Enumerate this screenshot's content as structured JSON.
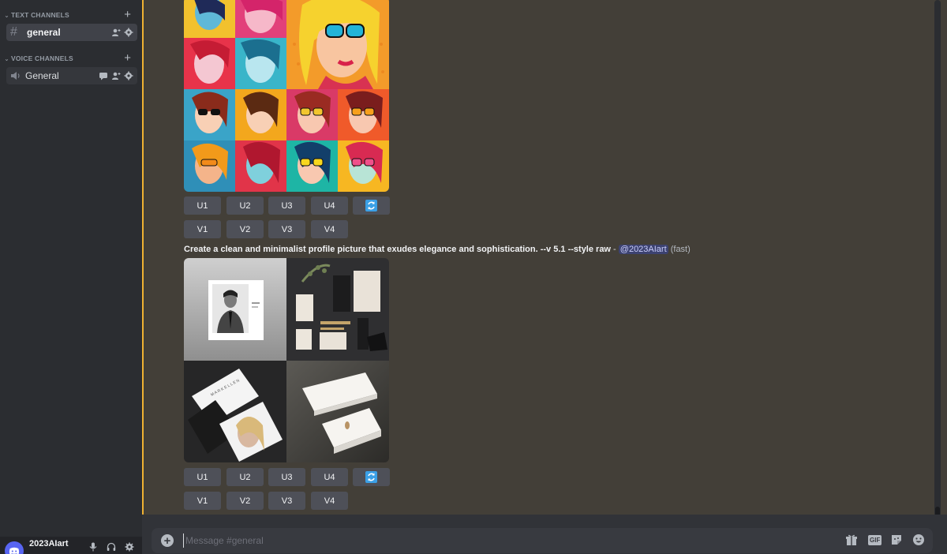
{
  "sidebar": {
    "categories": [
      {
        "label": "TEXT CHANNELS"
      },
      {
        "label": "VOICE CHANNELS"
      }
    ],
    "channels": [
      {
        "label": "general",
        "type": "text"
      },
      {
        "label": "General",
        "type": "voice"
      }
    ]
  },
  "user": {
    "name": "2023AIart"
  },
  "messages": [
    {
      "buttons_u": [
        "U1",
        "U2",
        "U3",
        "U4"
      ],
      "buttons_v": [
        "V1",
        "V2",
        "V3",
        "V4"
      ]
    },
    {
      "prompt": "Create a clean and minimalist profile picture that exudes elegance and sophistication. --v 5.1 --style raw",
      "separator": " - ",
      "mention": "@2023AIart",
      "mode": "(fast)",
      "buttons_u": [
        "U1",
        "U2",
        "U3",
        "U4"
      ],
      "buttons_v": [
        "V1",
        "V2",
        "V3",
        "V4"
      ]
    }
  ],
  "composer": {
    "placeholder": "Message #general"
  },
  "colors": {
    "accent": "#f0b232",
    "reroll": "#3ba0e6",
    "mention_bg": "#3c4270"
  }
}
